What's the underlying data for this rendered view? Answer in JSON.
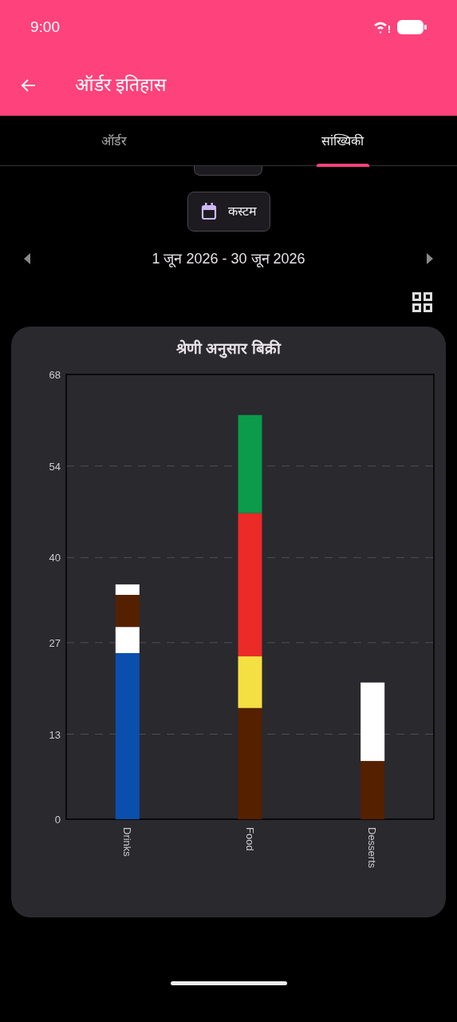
{
  "status_bar": {
    "time": "9:00"
  },
  "app_bar": {
    "title": "ऑर्डर इतिहास"
  },
  "tabs": [
    {
      "label": "ऑर्डर",
      "selected": false
    },
    {
      "label": "सांख्यिकी",
      "selected": true
    }
  ],
  "range_chip": {
    "label": "कस्टम"
  },
  "date_range": "1 जून 2026 - 30 जून 2026",
  "chart_card": {
    "title": "श्रेणी अनुसार बिक्री",
    "chart_data": {
      "type": "bar",
      "stacked": true,
      "grid": true,
      "categories": [
        "Drinks",
        "Food",
        "Desserts"
      ],
      "ylim": [
        0,
        68
      ],
      "yticks": [
        0,
        13,
        27,
        40,
        54,
        68
      ],
      "series": [
        {
          "color": "#0a4fae",
          "values": [
            25.4,
            null,
            null
          ]
        },
        {
          "color": "#552000",
          "values": [
            null,
            17,
            8.9
          ]
        },
        {
          "color": "#ffffff",
          "values": [
            4,
            null,
            12
          ]
        },
        {
          "color": "#f4e042",
          "values": [
            null,
            7.9,
            null
          ]
        },
        {
          "color": "#552000",
          "values": [
            4.9,
            null,
            null
          ]
        },
        {
          "color": "#ec2a27",
          "values": [
            null,
            21.9,
            null
          ]
        },
        {
          "color": "#ffffff",
          "values": [
            1.6,
            null,
            null
          ]
        },
        {
          "color": "#0b9b4a",
          "values": [
            null,
            15,
            null
          ]
        }
      ]
    }
  }
}
